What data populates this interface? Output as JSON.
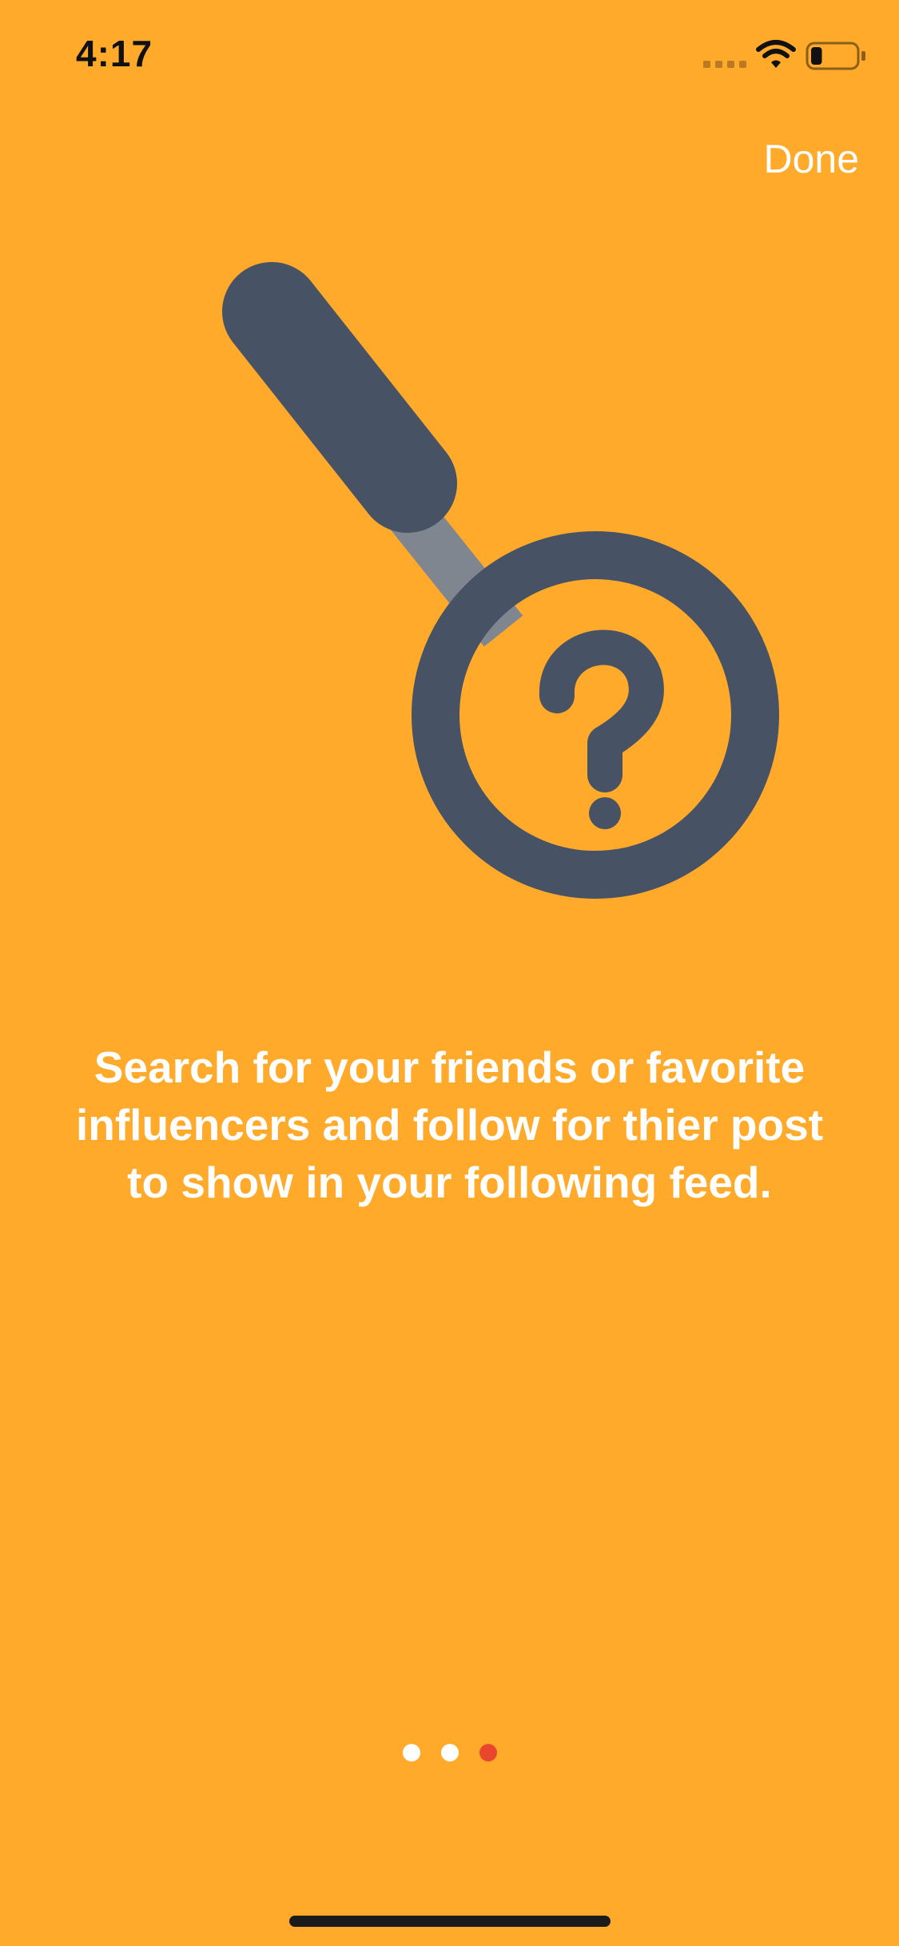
{
  "status_bar": {
    "time": "4:17",
    "signal_icon": "cellular-signal-icon",
    "wifi_icon": "wifi-icon",
    "battery_icon": "battery-icon",
    "battery_level": 0.25
  },
  "nav": {
    "done_label": "Done"
  },
  "illustration": {
    "icon": "magnifying-glass-question-icon",
    "colors": {
      "handle": "#475264",
      "neck": "#7F868F",
      "ring": "#475264",
      "background": "#FFAA2B"
    }
  },
  "content": {
    "description": "Search for your friends or favorite influencers and follow for thier post to show in your following feed."
  },
  "pager": {
    "total": 3,
    "current_page": 3,
    "active_color": "#E8472E",
    "inactive_color": "#FFFFFF"
  },
  "colors": {
    "background": "#FFAA2B",
    "text": "#FFFFFF"
  }
}
